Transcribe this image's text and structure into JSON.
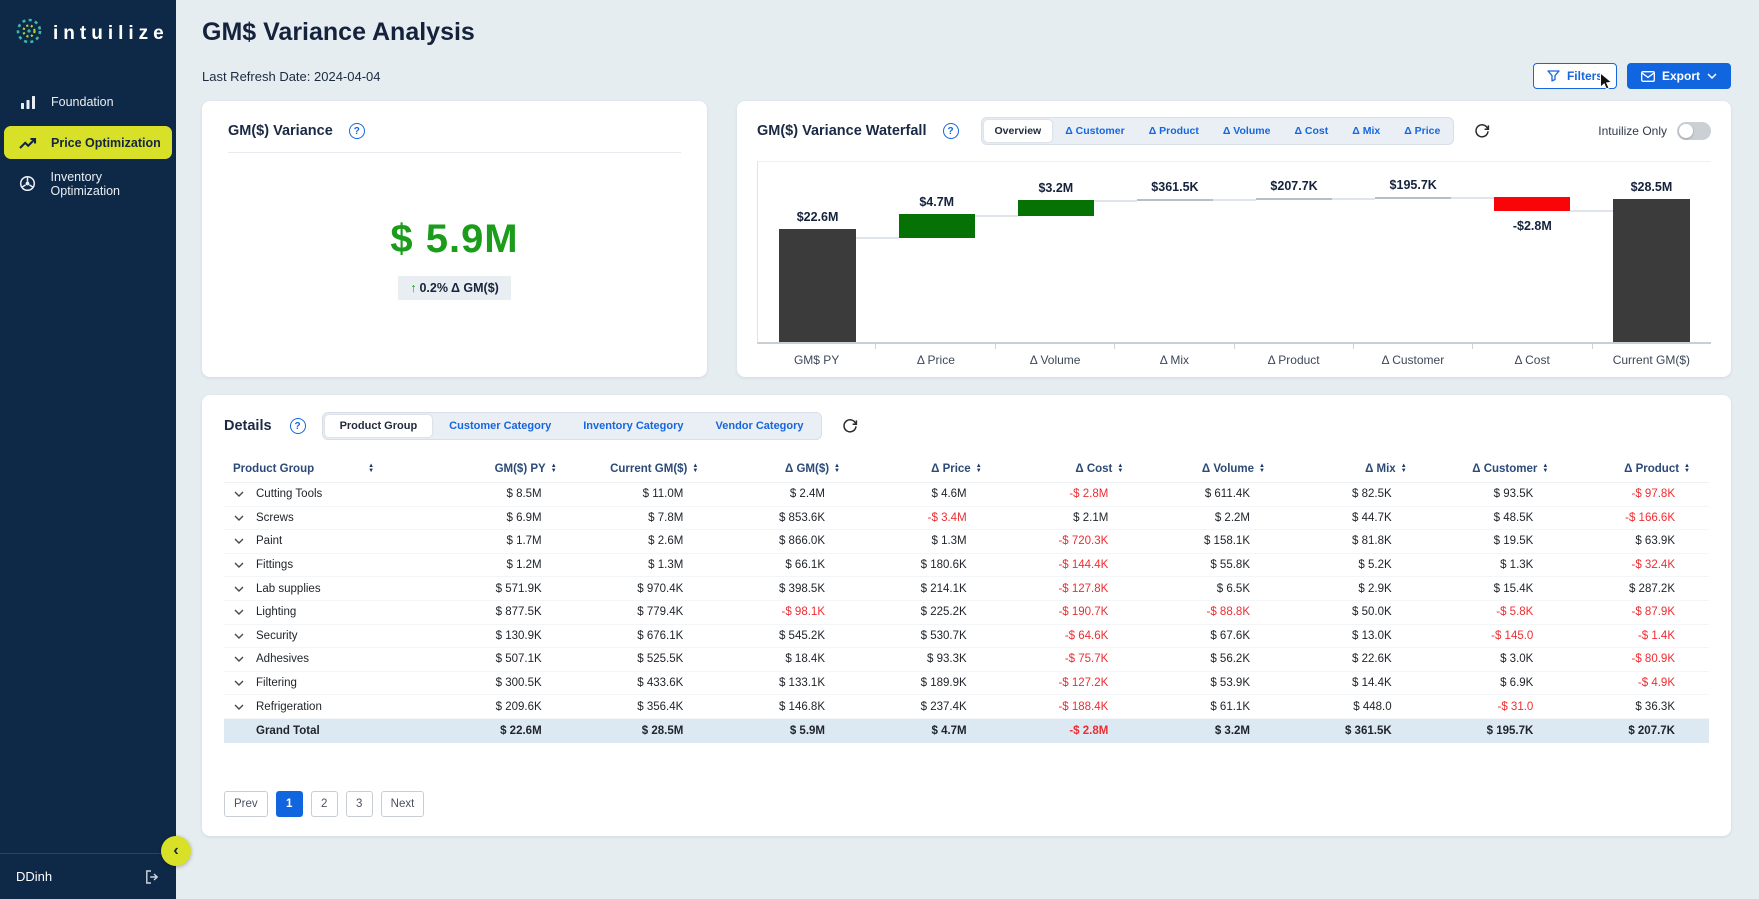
{
  "sidebar": {
    "logo_text": "intuilize",
    "items": [
      {
        "label": "Foundation",
        "icon": "bar-chart",
        "active": false
      },
      {
        "label": "Price Optimization",
        "icon": "trending-up",
        "active": true
      },
      {
        "label": "Inventory Optimization",
        "icon": "wheel",
        "active": false
      }
    ],
    "user_name": "DDinh"
  },
  "header": {
    "title": "GM$ Variance Analysis",
    "last_refresh": "Last Refresh Date: 2024-04-04",
    "filters_button": "Filters",
    "export_button": "Export"
  },
  "variance_card": {
    "title": "GM($) Variance",
    "value": "$ 5.9M",
    "delta_arrow": "↑",
    "delta_text": "0.2% Δ GM($)"
  },
  "waterfall_card": {
    "title": "GM($) Variance Waterfall",
    "tabs": [
      {
        "label": "Overview",
        "active": true
      },
      {
        "label": "Δ Customer"
      },
      {
        "label": "Δ Product"
      },
      {
        "label": "Δ Volume"
      },
      {
        "label": "Δ Cost"
      },
      {
        "label": "Δ Mix"
      },
      {
        "label": "Δ Price"
      }
    ],
    "toggle_label": "Intuilize Only",
    "toggle_state": "off"
  },
  "chart_data": {
    "type": "bar",
    "subtype": "waterfall",
    "title": "GM($) Variance Waterfall",
    "categories": [
      "GM$ PY",
      "Δ Price",
      "Δ Volume",
      "Δ Mix",
      "Δ Product",
      "Δ Customer",
      "Δ Cost",
      "Current GM($)"
    ],
    "values_musd": [
      22.6,
      4.7,
      3.2,
      0.3615,
      0.2077,
      0.1957,
      -2.8,
      28.5
    ],
    "labels": [
      "$22.6M",
      "$4.7M",
      "$3.2M",
      "$361.5K",
      "$207.7K",
      "$195.7K",
      "-$2.8M",
      "$28.5M"
    ],
    "bar_kinds": [
      "total",
      "increase",
      "increase",
      "increase",
      "increase",
      "increase",
      "decrease",
      "total"
    ],
    "ylim": [
      0,
      39
    ],
    "grid": false,
    "colors": {
      "total": "#3b3b3b",
      "increase": "#067206",
      "decrease": "#f90408",
      "tiny": "#b2c0ca"
    }
  },
  "details": {
    "title": "Details",
    "tabs": [
      {
        "label": "Product Group",
        "active": true
      },
      {
        "label": "Customer Category"
      },
      {
        "label": "Inventory Category"
      },
      {
        "label": "Vendor Category"
      }
    ],
    "columns": [
      "Product Group",
      "GM($) PY",
      "Current GM($)",
      "Δ GM($)",
      "Δ Price",
      "Δ Cost",
      "Δ Volume",
      "Δ Mix",
      "Δ Customer",
      "Δ Product"
    ],
    "rows": [
      {
        "name": "Cutting Tools",
        "values": [
          "$ 8.5M",
          "$ 11.0M",
          "$ 2.4M",
          "$ 4.6M",
          "-$ 2.8M",
          "$ 611.4K",
          "$ 82.5K",
          "$ 93.5K",
          "-$ 97.8K"
        ]
      },
      {
        "name": "Screws",
        "values": [
          "$ 6.9M",
          "$ 7.8M",
          "$ 853.6K",
          "-$ 3.4M",
          "$ 2.1M",
          "$ 2.2M",
          "$ 44.7K",
          "$ 48.5K",
          "-$ 166.6K"
        ]
      },
      {
        "name": "Paint",
        "values": [
          "$ 1.7M",
          "$ 2.6M",
          "$ 866.0K",
          "$ 1.3M",
          "-$ 720.3K",
          "$ 158.1K",
          "$ 81.8K",
          "$ 19.5K",
          "$ 63.9K"
        ]
      },
      {
        "name": "Fittings",
        "values": [
          "$ 1.2M",
          "$ 1.3M",
          "$ 66.1K",
          "$ 180.6K",
          "-$ 144.4K",
          "$ 55.8K",
          "$ 5.2K",
          "$ 1.3K",
          "-$ 32.4K"
        ]
      },
      {
        "name": "Lab supplies",
        "values": [
          "$ 571.9K",
          "$ 970.4K",
          "$ 398.5K",
          "$ 214.1K",
          "-$ 127.8K",
          "$ 6.5K",
          "$ 2.9K",
          "$ 15.4K",
          "$ 287.2K"
        ]
      },
      {
        "name": "Lighting",
        "values": [
          "$ 877.5K",
          "$ 779.4K",
          "-$ 98.1K",
          "$ 225.2K",
          "-$ 190.7K",
          "-$ 88.8K",
          "$ 50.0K",
          "-$ 5.8K",
          "-$ 87.9K"
        ]
      },
      {
        "name": "Security",
        "values": [
          "$ 130.9K",
          "$ 676.1K",
          "$ 545.2K",
          "$ 530.7K",
          "-$ 64.6K",
          "$ 67.6K",
          "$ 13.0K",
          "-$ 145.0",
          "-$ 1.4K"
        ]
      },
      {
        "name": "Adhesives",
        "values": [
          "$ 507.1K",
          "$ 525.5K",
          "$ 18.4K",
          "$ 93.3K",
          "-$ 75.7K",
          "$ 56.2K",
          "$ 22.6K",
          "$ 3.0K",
          "-$ 80.9K"
        ]
      },
      {
        "name": "Filtering",
        "values": [
          "$ 300.5K",
          "$ 433.6K",
          "$ 133.1K",
          "$ 189.9K",
          "-$ 127.2K",
          "$ 53.9K",
          "$ 14.4K",
          "$ 6.9K",
          "-$ 4.9K"
        ]
      },
      {
        "name": "Refrigeration",
        "values": [
          "$ 209.6K",
          "$ 356.4K",
          "$ 146.8K",
          "$ 237.4K",
          "-$ 188.4K",
          "$ 61.1K",
          "$ 448.0",
          "-$ 31.0",
          "$ 36.3K"
        ]
      }
    ],
    "grand_total": {
      "name": "Grand Total",
      "values": [
        "$ 22.6M",
        "$ 28.5M",
        "$ 5.9M",
        "$ 4.7M",
        "-$ 2.8M",
        "$ 3.2M",
        "$ 361.5K",
        "$ 195.7K",
        "$ 207.7K"
      ]
    },
    "pagination": {
      "prev": "Prev",
      "pages": [
        "1",
        "2",
        "3"
      ],
      "active_page": "1",
      "next": "Next"
    }
  }
}
